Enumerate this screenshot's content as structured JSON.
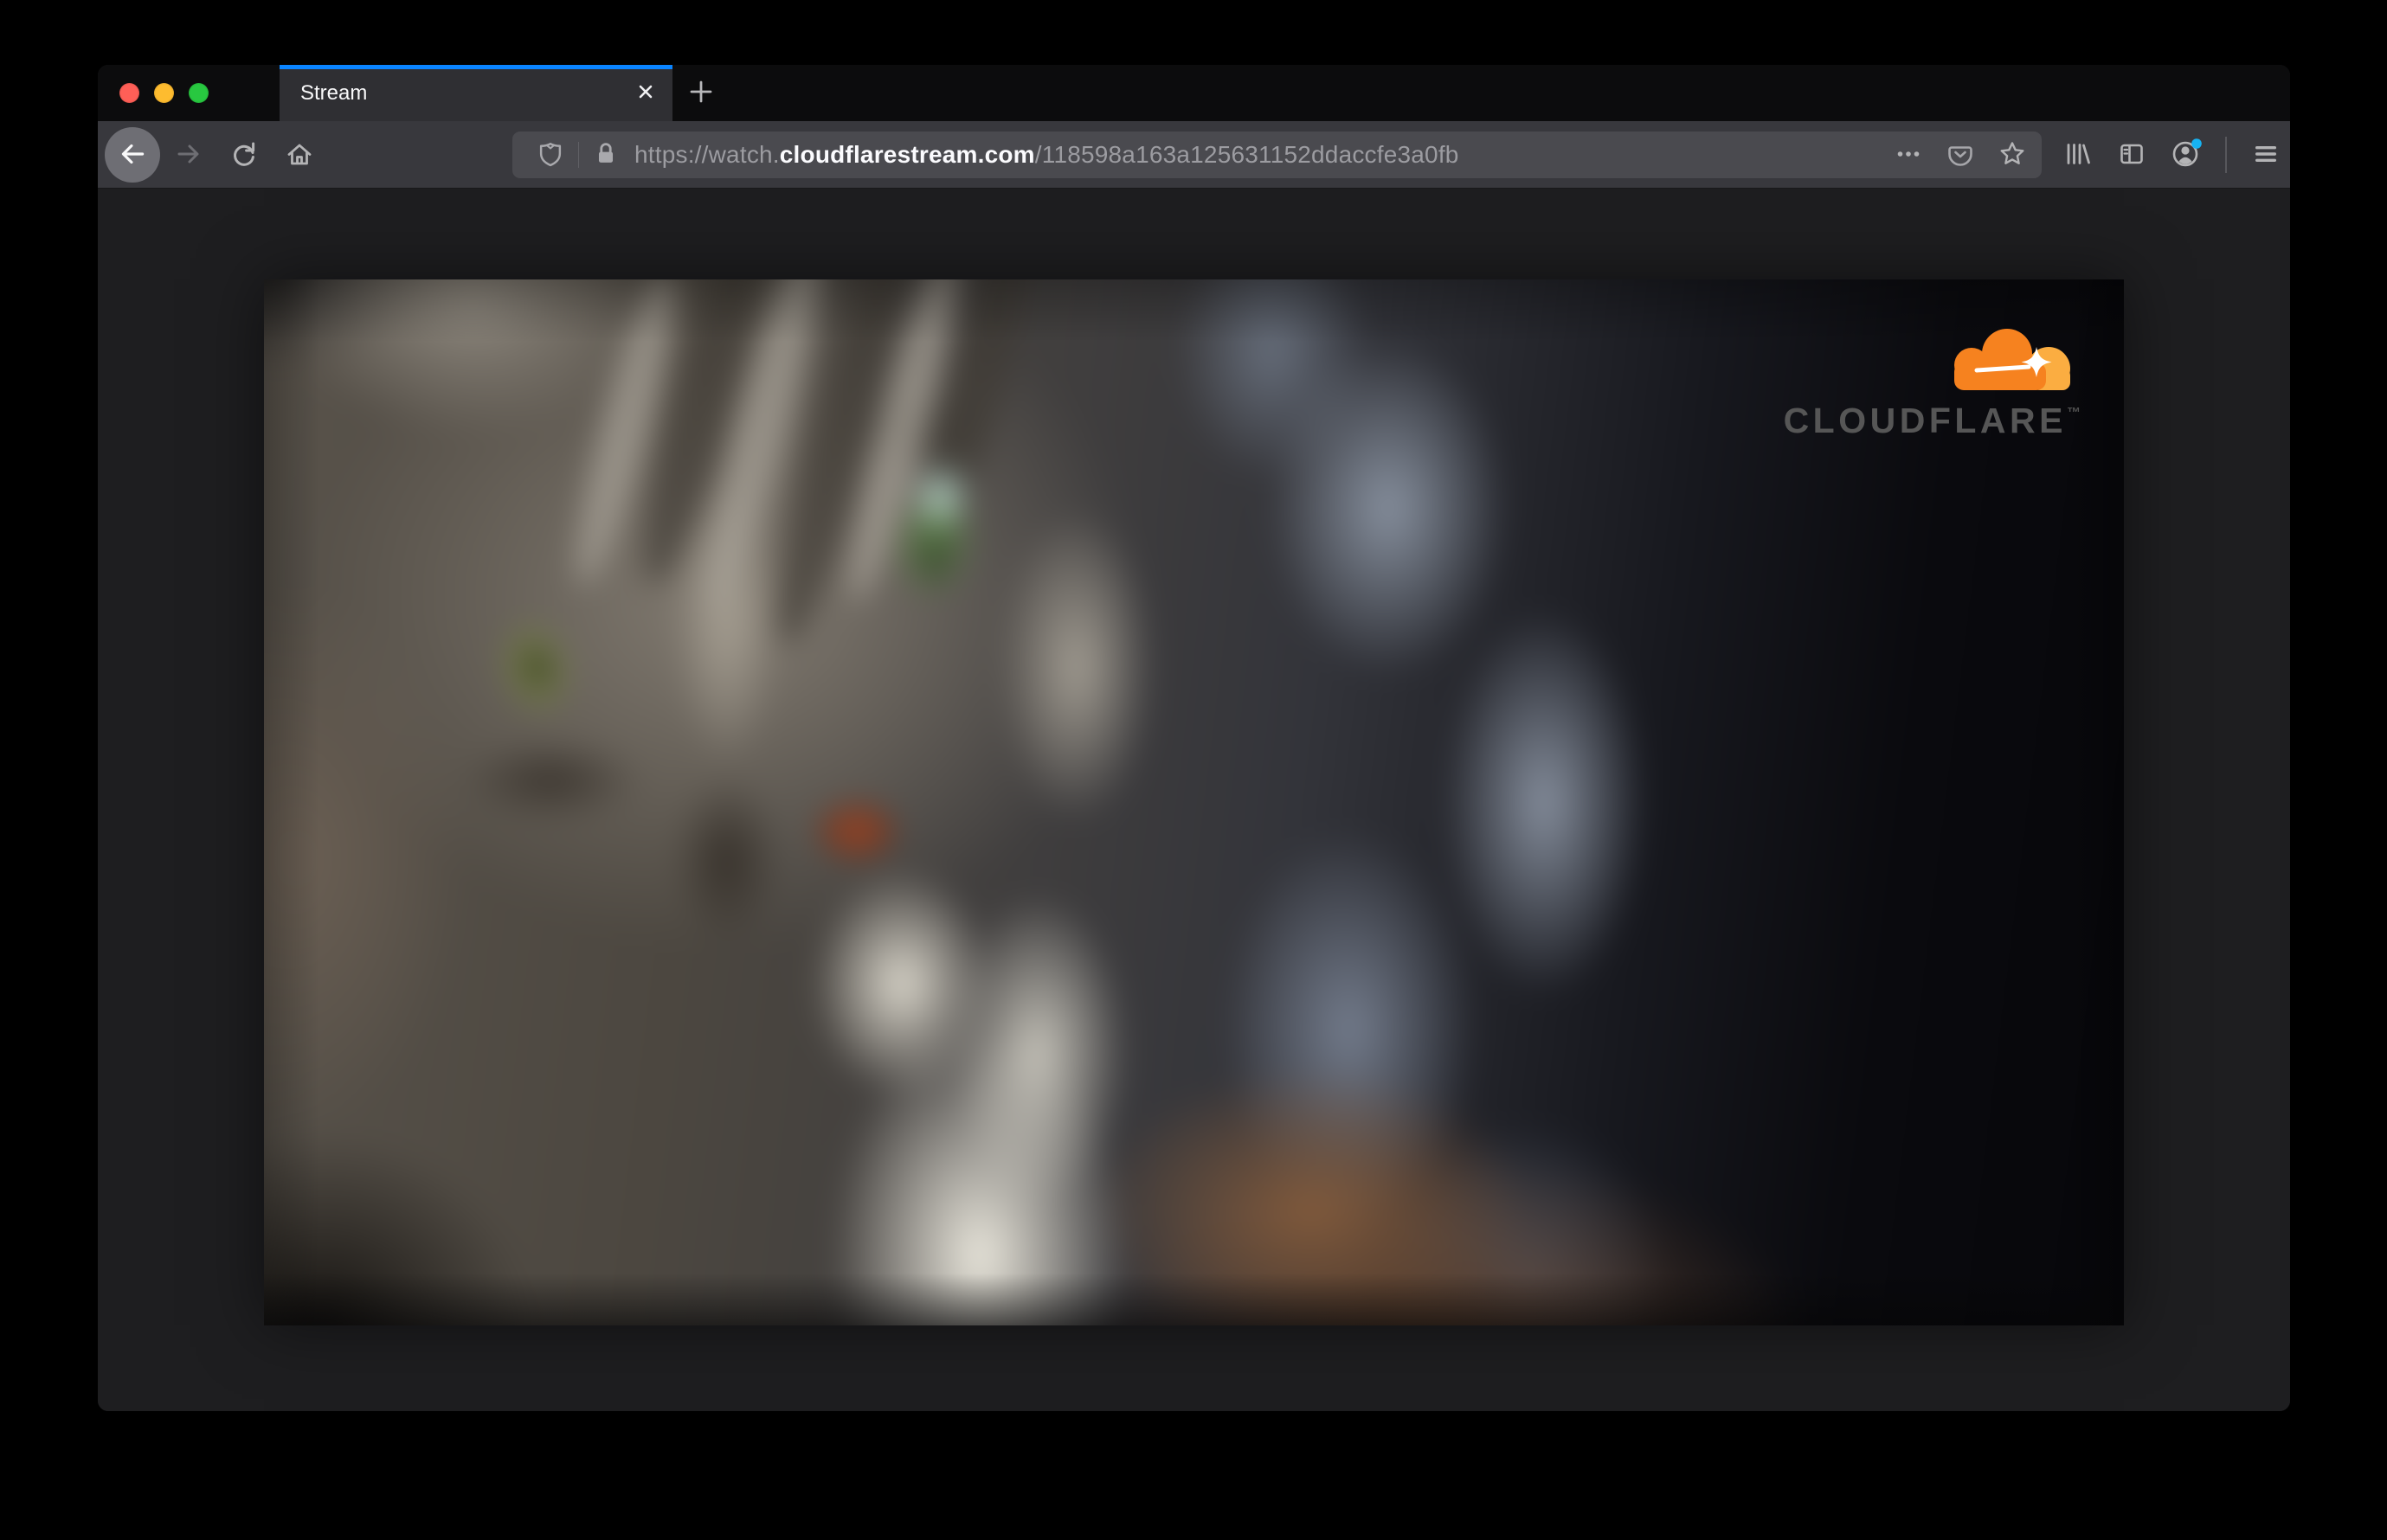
{
  "tab_bar": {
    "active_tab_title": "Stream"
  },
  "address_bar": {
    "url_prefix": "https://watch.",
    "url_domain": "cloudflarestream.com",
    "url_path": "/118598a163a125631152ddaccfe3a0fb"
  },
  "video_player": {
    "brand_wordmark": "CLOUDFLARE",
    "brand_trademark": "™"
  },
  "icons": {
    "traffic_close": "red-circle",
    "traffic_minimize": "yellow-circle",
    "traffic_zoom": "green-circle",
    "close_tab": "x-glyph",
    "new_tab": "plus-glyph",
    "back": "left-arrow",
    "forward": "right-arrow",
    "reload": "circular-arrow",
    "home": "house",
    "tracking_protection": "shield",
    "site_security": "padlock",
    "page_actions": "three-dots",
    "pocket": "pocket-pouch-chevron",
    "bookmark": "star-outline",
    "library": "book-spines",
    "sidebar": "split-panel",
    "account": "person-in-circle",
    "menu": "hamburger-lines",
    "cloudflare_logo": "orange-cloud-with-sparkle"
  },
  "colors": {
    "accent_blue": "#0a84ff",
    "traffic_red": "#ff5f57",
    "traffic_yellow": "#febc2f",
    "traffic_green": "#28c840",
    "toolbar_bg": "#38383d",
    "tabbar_bg": "#0c0c0d",
    "addressbar_bg": "#4a4a4f",
    "content_bg": "#1e1e20",
    "cloudflare_orange": "#f6821f",
    "cloudflare_orange_light": "#fbad41",
    "account_badge": "#17b3f2"
  }
}
